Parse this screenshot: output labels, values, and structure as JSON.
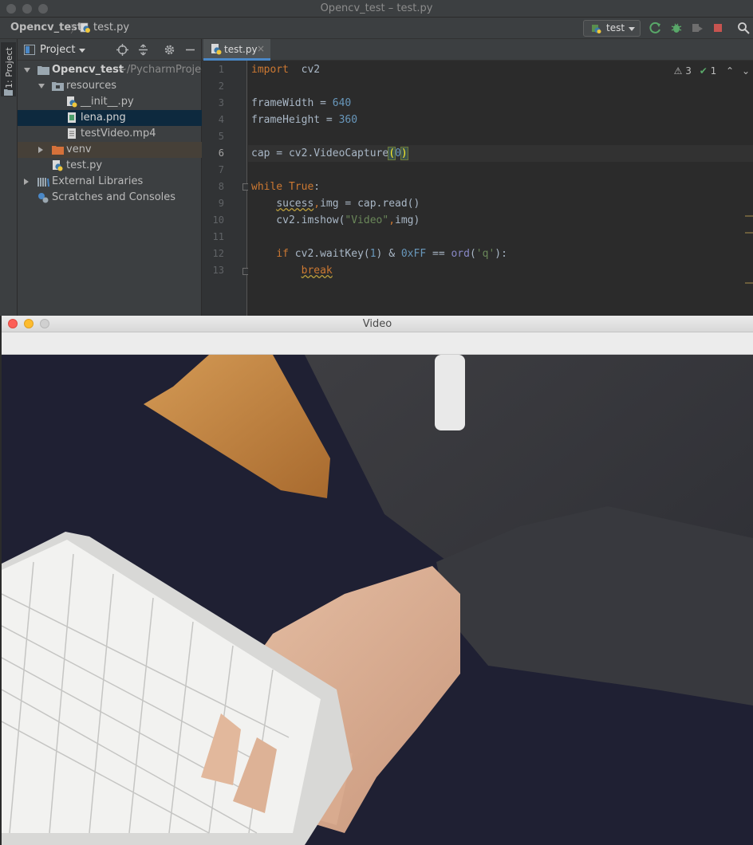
{
  "ide": {
    "window_title": "Opencv_test – test.py",
    "breadcrumb": {
      "project": "Opencv_test",
      "file": "test.py"
    },
    "run_config": "test",
    "project_panel": {
      "header": "Project",
      "side_tab": "1: Project",
      "tree": {
        "root_name": "Opencv_test",
        "root_path": "~/PycharmProject",
        "resources": "resources",
        "init_file": "__init__.py",
        "lena": "lena.png",
        "video": "testVideo.mp4",
        "venv": "venv",
        "test_py": "test.py",
        "ext_libs": "External Libraries",
        "scratches": "Scratches and Consoles"
      }
    },
    "editor": {
      "tab_label": "test.py",
      "tab_close": "×",
      "inspections": {
        "warnings": "3",
        "ok": "1"
      },
      "line_numbers": [
        "1",
        "2",
        "3",
        "4",
        "5",
        "6",
        "7",
        "8",
        "9",
        "10",
        "11",
        "12",
        "13"
      ],
      "current_line": "6"
    }
  },
  "video_window": {
    "title": "Video"
  },
  "colors": {
    "ide_bg": "#2b2b2b",
    "panel_bg": "#3c3f41",
    "selection": "#0d293e",
    "keyword": "#cc7832",
    "number": "#6897bb",
    "string": "#6a8759",
    "close_light": "#fc5f57",
    "minimize_light": "#fdbc2e"
  }
}
